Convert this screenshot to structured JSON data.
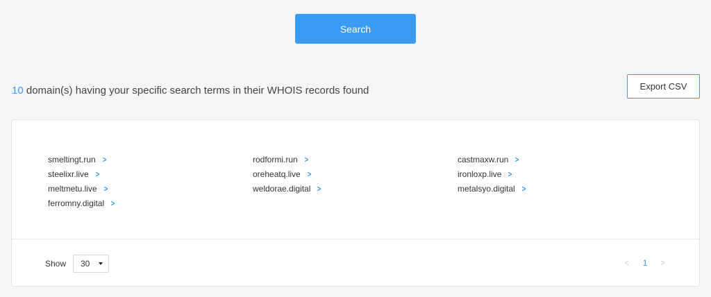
{
  "search": {
    "button_label": "Search"
  },
  "results": {
    "count": "10",
    "heading_text": " domain(s) having your specific search terms in their WHOIS records found",
    "export_label": "Export CSV"
  },
  "domains": [
    "smeltingt.run",
    "rodformi.run",
    "castmaxw.run",
    "steelixr.live",
    "oreheatq.live",
    "ironloxp.live",
    "meltmetu.live",
    "weldorae.digital",
    "metalsyo.digital",
    "ferromny.digital"
  ],
  "pagination": {
    "show_label": "Show",
    "page_size": "30",
    "current_page": "1",
    "prev_icon": "chevron-left-icon",
    "next_icon": "chevron-right-icon"
  },
  "colors": {
    "accent": "#3a9bf4",
    "background": "#f5f6f8",
    "card": "#ffffff"
  }
}
